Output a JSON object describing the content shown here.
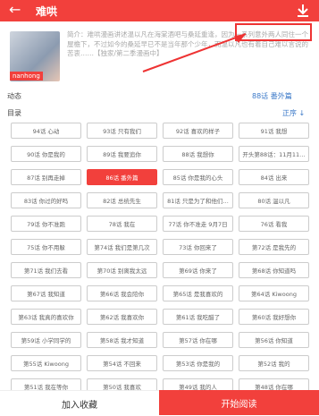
{
  "header": {
    "title": "难哄"
  },
  "book": {
    "cover_tag": "nanhong",
    "intro": "简介：难哄漫画讲述温以凡在海棠酒吧与桑延重逢，因为一系列意外两人同住一个屋檐下，不过如今的桑延早已不是当年那个少年，而温以凡也有着自己难以言说的苦衷……【独家/第二季漫画中】"
  },
  "latest": {
    "label": "动态",
    "link": "88话 番外篇"
  },
  "catalog": {
    "label": "目录",
    "sort_label": "正序 ↓",
    "chapters": [
      "94话 心动",
      "93话 只有我们",
      "92话 喜欢的样子",
      "91话 我想",
      "90话 你是我的",
      "89话 我要追你",
      "88话 我想你",
      "开头第88话：11月11…",
      "87话 别再走掉",
      "86话 番外篇",
      "85话 你是我的心头",
      "84话 出来",
      "83话 你过的好吗",
      "82话 总统先生",
      "81话 只是为了和他们…",
      "80话 温以凡"
    ],
    "more_chapters": [
      "79话 你不准跑",
      "78话 我在",
      "77话 你不准走 9月7日",
      "76话 看我",
      "75话 你不用躲",
      "第74话 我们是第几次",
      "73话 你回来了",
      "第72话 是我先的",
      "第71话 我们去看",
      "第70话 别离我太远",
      "第69话 你来了",
      "第68话 你知道吗",
      "第67话 我知道",
      "第66话 我会陪你",
      "第65话 是我喜欢的",
      "第64话 Kiwoong",
      "第63话 我真的喜欢你",
      "第62话 我喜欢你",
      "第61话 我吃醋了",
      "第60话 我好想你",
      "第59话 小学同学的",
      "第58话 我才知道",
      "第57话 你在哪",
      "第56话 你知道",
      "第55话 Kiwoong",
      "第54话 不回来",
      "第53话 你是我的",
      "第52话 我的",
      "第51话 我在等你",
      "第50话 我喜欢",
      "第49话 我的人",
      "第48话 你在哪"
    ]
  },
  "bottom": {
    "collect": "加入收藏",
    "read": "开始阅读"
  }
}
